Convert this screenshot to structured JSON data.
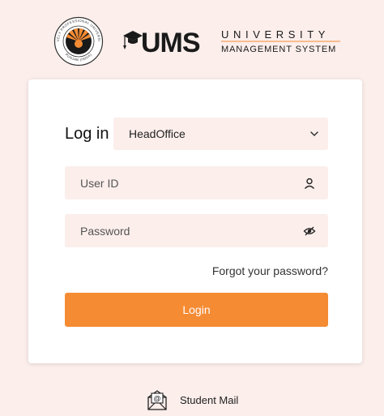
{
  "branding": {
    "seal_text_top": "LOVELY PROFESSIONAL UNIVERSITY",
    "seal_text_bottom": "PUNJAB (INDIA)",
    "logo_ums": "UMS",
    "logo_university": "UNIVERSITY",
    "logo_subtitle": "MANAGEMENT SYSTEM",
    "accent": "#f58b33",
    "dark": "#1a1a1a"
  },
  "login": {
    "heading": "Log in",
    "campus_selected": "HeadOffice",
    "userid_placeholder": "User ID",
    "password_placeholder": "Password",
    "forgot_label": "Forgot your password?",
    "button_label": "Login"
  },
  "footer": {
    "student_mail_label": "Student Mail"
  },
  "icons": {
    "user": "user-icon",
    "eye": "eye-slash-icon",
    "chevron": "chevron-down-icon",
    "mail": "mail-icon"
  }
}
